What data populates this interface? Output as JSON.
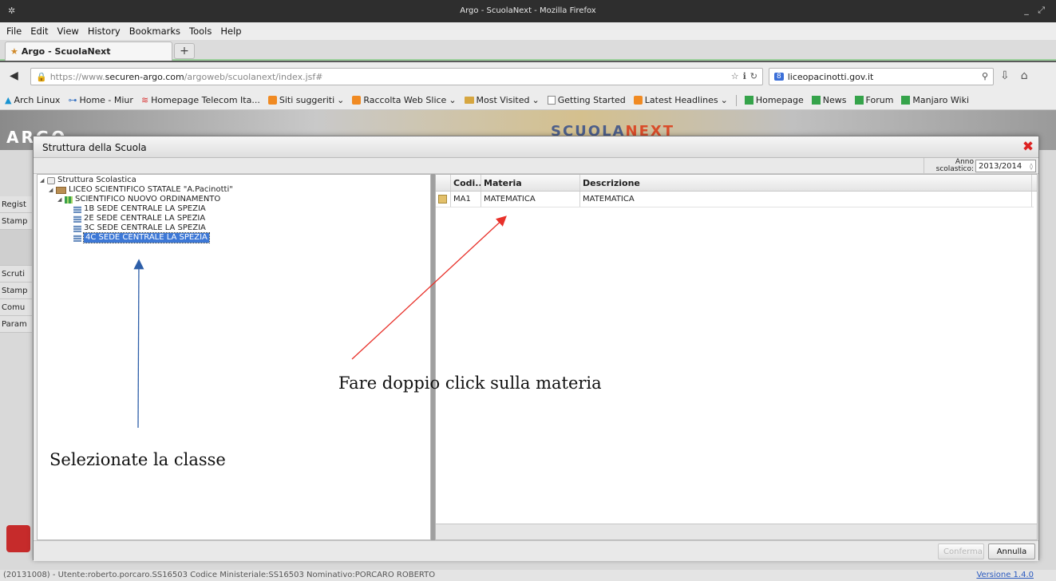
{
  "window": {
    "title": "Argo - ScuolaNext - Mozilla Firefox"
  },
  "menu": [
    "File",
    "Edit",
    "View",
    "History",
    "Bookmarks",
    "Tools",
    "Help"
  ],
  "tab": {
    "label": "Argo - ScuolaNext",
    "new_tab": "+"
  },
  "nav": {
    "url_scheme": "https://www.",
    "url_host": "securen-argo.com",
    "url_path": "/argoweb/scuolanext/index.jsf#",
    "search_engine": "8",
    "search_value": "liceopacinotti.gov.it"
  },
  "bookmarks": [
    {
      "label": "Arch Linux",
      "icon": "arch-icon"
    },
    {
      "label": "Home - Miur",
      "icon": "miur-icon"
    },
    {
      "label": "Homepage Telecom Ita...",
      "icon": "telecom-icon"
    },
    {
      "label": "Siti suggeriti",
      "icon": "rss-icon",
      "dropdown": true
    },
    {
      "label": "Raccolta Web Slice",
      "icon": "rss-icon",
      "dropdown": true
    },
    {
      "label": "Most Visited",
      "icon": "folder-icon",
      "dropdown": true
    },
    {
      "label": "Getting Started",
      "icon": "page-icon"
    },
    {
      "label": "Latest Headlines",
      "icon": "rss-icon",
      "dropdown": true
    },
    {
      "label": "Homepage",
      "icon": "manjaro-icon"
    },
    {
      "label": "News",
      "icon": "manjaro-icon"
    },
    {
      "label": "Forum",
      "icon": "manjaro-icon"
    },
    {
      "label": "Manjaro Wiki",
      "icon": "manjaro-icon"
    }
  ],
  "app": {
    "logo": "ARGO",
    "brand_left": "SCUOLA",
    "brand_right": "NEXT",
    "side_menu": [
      "Regist",
      "Stamp",
      "Scruti",
      "Stamp",
      "Comu",
      "Param"
    ]
  },
  "dialog": {
    "title": "Struttura della Scuola",
    "anno_label_1": "Anno",
    "anno_label_2": "scolastico:",
    "anno_value": "2013/2014",
    "tree": [
      {
        "label": "Struttura Scolastica",
        "level": 0,
        "icon": "structure",
        "expanded": true,
        "selected": false
      },
      {
        "label": "LICEO SCIENTIFICO STATALE \"A.Pacinotti\"",
        "level": 1,
        "icon": "school",
        "expanded": true,
        "selected": false
      },
      {
        "label": "SCIENTIFICO NUOVO ORDINAMENTO",
        "level": 2,
        "icon": "course",
        "expanded": true,
        "selected": false
      },
      {
        "label": "1B SEDE CENTRALE LA SPEZIA",
        "level": 3,
        "icon": "class",
        "expanded": false,
        "selected": false
      },
      {
        "label": "2E SEDE CENTRALE LA SPEZIA",
        "level": 3,
        "icon": "class",
        "expanded": false,
        "selected": false
      },
      {
        "label": "3C SEDE CENTRALE LA SPEZIA",
        "level": 3,
        "icon": "class",
        "expanded": false,
        "selected": false
      },
      {
        "label": "4C SEDE CENTRALE LA SPEZIA",
        "level": 3,
        "icon": "class",
        "expanded": false,
        "selected": true
      }
    ],
    "grid": {
      "columns": [
        "Codi...",
        "Materia",
        "Descrizione"
      ],
      "rows": [
        {
          "code": "MA1",
          "materia": "MATEMATICA",
          "descrizione": "MATEMATICA"
        }
      ]
    },
    "buttons": {
      "confirm": "Conferma",
      "cancel": "Annulla"
    }
  },
  "annotations": {
    "materia": "Fare doppio click sulla materia",
    "classe": "Selezionate la classe",
    "red_arrow_color": "#e8312a",
    "blue_arrow_color": "#2d5ea8"
  },
  "status": {
    "text": "(20131008) - Utente:roberto.porcaro.SS16503 Codice Ministeriale:SS16503 Nominativo:PORCARO ROBERTO",
    "version": "Versione 1.4.0"
  }
}
